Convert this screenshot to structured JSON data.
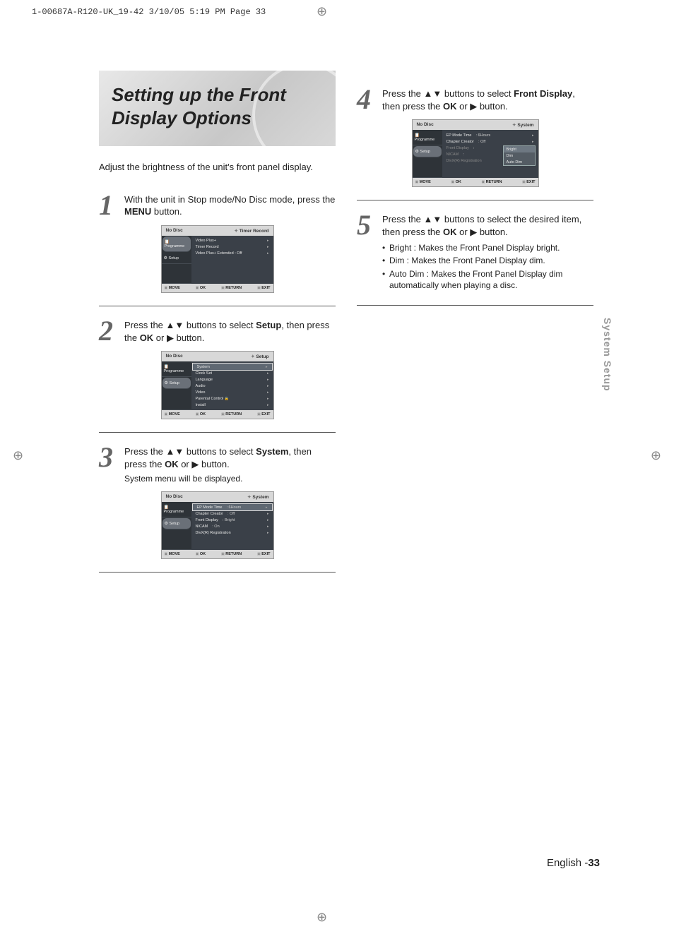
{
  "print_header": "1-00687A-R120-UK_19-42  3/10/05  5:19 PM  Page 33",
  "side_tab": "System Setup",
  "footer_lang": "English -",
  "footer_page": "33",
  "title": "Setting up the Front Display Options",
  "intro": "Adjust the brightness of the unit's front panel display.",
  "step1_num": "1",
  "step1_a": "With the unit in Stop mode/No Disc mode, press the ",
  "step1_b": "MENU",
  "step1_c": " button.",
  "step2_num": "2",
  "step2_a": "Press the ",
  "step2_b": " buttons to select ",
  "step2_c": "Setup",
  "step2_d": ", then press the ",
  "step2_e": "OK",
  "step2_f": " or ",
  "step2_g": " button.",
  "step3_num": "3",
  "step3_a": "Press the ",
  "step3_b": " buttons to select ",
  "step3_c": "System",
  "step3_d": ", then press the ",
  "step3_e": "OK",
  "step3_f": " or ",
  "step3_g": " button.",
  "step3_sub": "System menu will be displayed.",
  "step4_num": "4",
  "step4_a": "Press the ",
  "step4_b": " buttons to select ",
  "step4_c": "Front Display",
  "step4_d": ", then press the ",
  "step4_e": "OK",
  "step4_f": " or ",
  "step4_g": " button.",
  "step5_num": "5",
  "step5_a": "Press the ",
  "step5_b": " buttons to select the desired item, then press the ",
  "step5_c": "OK",
  "step5_d": " or ",
  "step5_e": " button.",
  "step5_bullet1": "Bright : Makes the Front Panel Display bright.",
  "step5_bullet2": "Dim : Makes the Front Panel Display dim.",
  "step5_bullet3": "Auto Dim : Makes the Front Panel Display dim automatically when playing a disc.",
  "arrow_ud": "▲▼",
  "arrow_r": "▶",
  "osd_common": {
    "no_disc": "No Disc",
    "side_programme": "Programme",
    "side_setup": "Setup",
    "move": "MOVE",
    "ok": "OK",
    "return": "RETURN",
    "exit": "EXIT"
  },
  "osd1": {
    "crumb": "Timer Record",
    "rows": [
      "Video Plus+",
      "Timer Record",
      "Video Plus+ Extended : Off"
    ]
  },
  "osd2": {
    "crumb": "Setup",
    "sel": "System",
    "rows": [
      "Clock Set",
      "Language",
      "Audio",
      "Video",
      "Parental Control",
      "Install"
    ]
  },
  "osd3": {
    "crumb": "System",
    "sel": {
      "label": "EP Mode Time",
      "val": ": 6Hours"
    },
    "rows": [
      {
        "label": "Chapter Creator",
        "val": ": Off"
      },
      {
        "label": "Front Display",
        "val": ": Bright"
      },
      {
        "label": "NICAM",
        "val": ": On"
      },
      {
        "label": "DivX(R) Registration",
        "val": ""
      }
    ]
  },
  "osd4": {
    "crumb": "System",
    "rows": [
      {
        "label": "EP Mode Time",
        "val": ": 6Hours"
      },
      {
        "label": "Chapter Creator",
        "val": ": Off"
      },
      {
        "label": "Front Display",
        "val": ":",
        "dim": true
      },
      {
        "label": "NICAM",
        "val": ":",
        "dim": true
      },
      {
        "label": "DivX(R) Registration",
        "val": "",
        "dim": true
      }
    ],
    "dropdown": [
      "Bright",
      "Dim",
      "Auto Dim"
    ],
    "dd_sel_index": 0
  }
}
